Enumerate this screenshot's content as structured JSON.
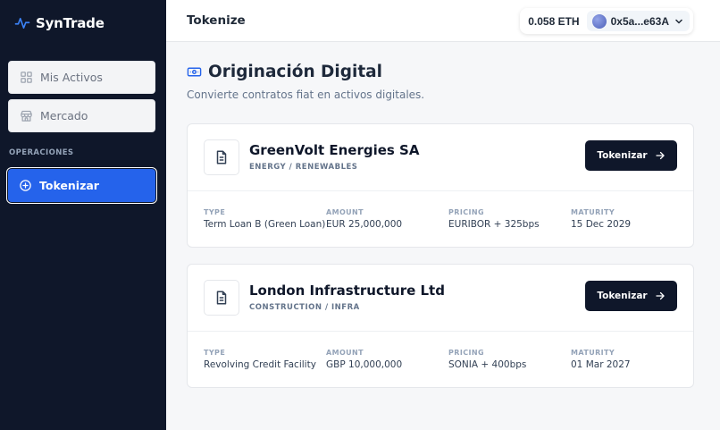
{
  "brand": {
    "name": "SynTrade",
    "colors": {
      "sidebar": "#0f172a",
      "accent": "#2563eb"
    }
  },
  "sidebar": {
    "items": [
      {
        "label": "Mis Activos",
        "icon": "grid-icon"
      },
      {
        "label": "Mercado",
        "icon": "store-icon"
      }
    ],
    "section_label": "OPERACIONES",
    "active_item": {
      "label": "Tokenizar",
      "icon": "plus-circle-icon"
    }
  },
  "topbar": {
    "title": "Tokenize",
    "wallet": {
      "balance": "0.058 ETH",
      "address": "0x5a...e63A"
    }
  },
  "main": {
    "title": "Originación Digital",
    "subtitle": "Convierte contratos fiat en activos digitales.",
    "deals": [
      {
        "company": "GreenVolt Energies SA",
        "sector": "ENERGY / RENEWABLES",
        "button": "Tokenizar",
        "fields": [
          {
            "label": "TYPE",
            "value": "Term Loan B (Green Loan)"
          },
          {
            "label": "AMOUNT",
            "value": "EUR 25,000,000"
          },
          {
            "label": "PRICING",
            "value": "EURIBOR + 325bps"
          },
          {
            "label": "MATURITY",
            "value": "15 Dec 2029"
          }
        ]
      },
      {
        "company": "London Infrastructure Ltd",
        "sector": "CONSTRUCTION / INFRA",
        "button": "Tokenizar",
        "fields": [
          {
            "label": "TYPE",
            "value": "Revolving Credit Facility"
          },
          {
            "label": "AMOUNT",
            "value": "GBP 10,000,000"
          },
          {
            "label": "PRICING",
            "value": "SONIA + 400bps"
          },
          {
            "label": "MATURITY",
            "value": "01 Mar 2027"
          }
        ]
      }
    ]
  }
}
